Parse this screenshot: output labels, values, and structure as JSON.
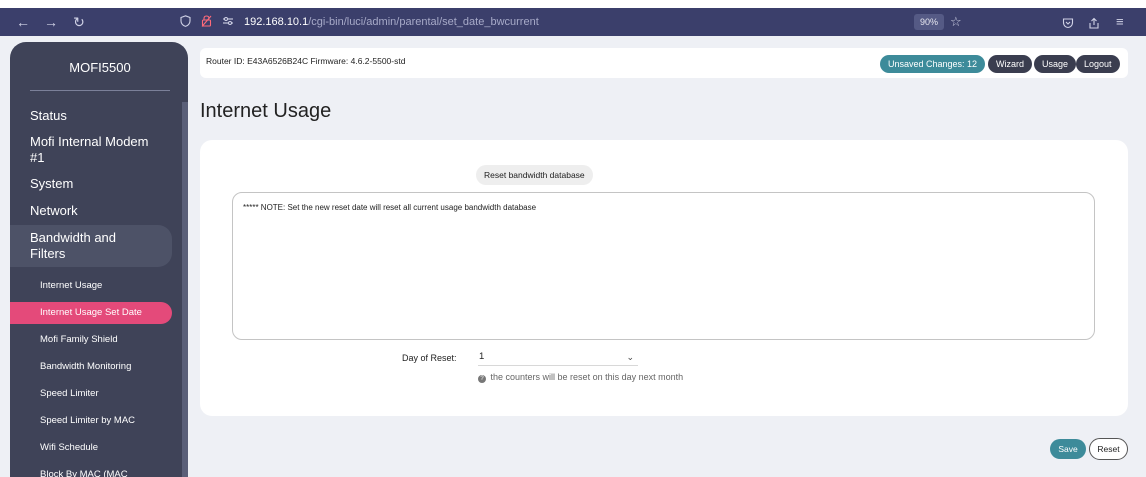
{
  "browser": {
    "back_icon": "←",
    "forward_icon": "→",
    "reload_icon": "↻",
    "url_host": "192.168.10.1",
    "url_path": "/cgi-bin/luci/admin/parental/set_date_bwcurrent",
    "zoom": "90%",
    "shield_icon": "shield-icon",
    "lock_icon": "lock-slash-icon",
    "permissions_icon": "permissions-icon",
    "bookmark_icon": "star-icon",
    "pocket_icon": "pocket-icon",
    "share_icon": "share-icon",
    "menu_icon": "hamburger-icon"
  },
  "sidebar": {
    "brand": "MOFI5500",
    "top_items": [
      {
        "label": "Status"
      },
      {
        "label": "Mofi Internal Modem #1"
      },
      {
        "label": "System"
      },
      {
        "label": "Network"
      },
      {
        "label": "Bandwidth and Filters"
      }
    ],
    "sub_items": [
      {
        "label": "Internet Usage"
      },
      {
        "label": "Internet Usage Set Date"
      },
      {
        "label": "Mofi Family Shield"
      },
      {
        "label": "Bandwidth Monitoring"
      },
      {
        "label": "Speed Limiter"
      },
      {
        "label": "Speed Limiter by MAC"
      },
      {
        "label": "Wifi Schedule"
      },
      {
        "label": "Block By MAC (MAC Filtering)"
      }
    ],
    "selected_sub_item": "Internet Usage Set Date"
  },
  "header": {
    "router_id_label": "Router ID:",
    "router_id": "E43A6526B24C",
    "firmware_label": "Firmware:",
    "firmware": "4.6.2-5500-std",
    "unsaved_changes": "Unsaved Changes: 12",
    "wizard": "Wizard",
    "usage": "Usage",
    "logout": "Logout"
  },
  "main": {
    "title": "Internet Usage",
    "reset_db_button": "Reset bandwidth database",
    "note": "***** NOTE: Set the new reset date will reset all current usage bandwidth database",
    "day_of_reset_label": "Day of Reset:",
    "day_of_reset_value": "1",
    "help_text": "the counters will be reset on this day next month"
  },
  "footer": {
    "save": "Save",
    "reset": "Reset"
  },
  "colors": {
    "browser_bar": "#3b3f6b",
    "sidebar_bg": "#3f4358",
    "selected_item": "#e44a7a",
    "accent_teal": "#3d8b9a"
  }
}
